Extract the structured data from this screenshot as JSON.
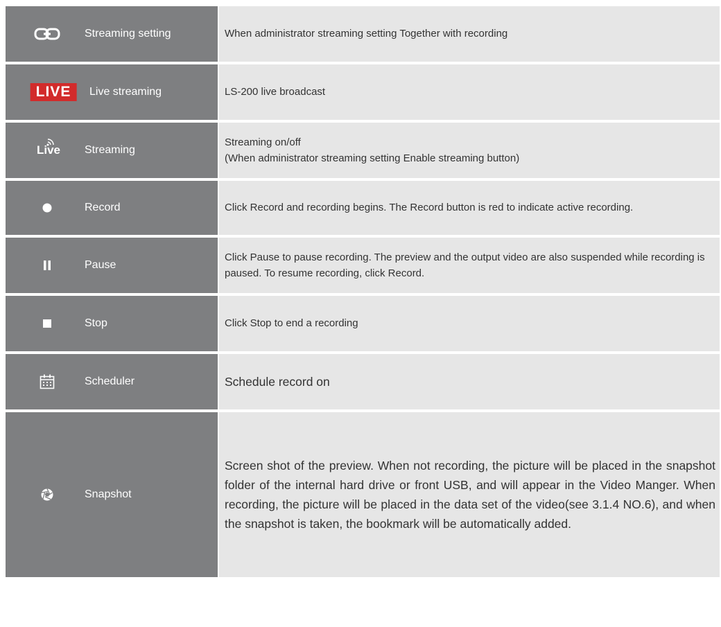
{
  "rows": [
    {
      "icon": "link-icon",
      "label": "Streaming setting",
      "desc": "When administrator streaming setting Together with recording"
    },
    {
      "icon": "live-badge-icon",
      "badge": "LIVE",
      "label": "Live streaming",
      "desc": "LS-200 live broadcast"
    },
    {
      "icon": "live-signal-icon",
      "label": "Streaming",
      "desc_lines": [
        "Streaming on/off",
        "(When administrator streaming setting Enable streaming button)"
      ]
    },
    {
      "icon": "record-dot-icon",
      "label": "Record",
      "desc": "Click Record and recording begins. The Record button is red to indicate active recording."
    },
    {
      "icon": "pause-icon",
      "label": "Pause",
      "desc": "Click Pause to pause recording. The preview and the output video are also suspended while recording is paused. To resume recording, click Record."
    },
    {
      "icon": "stop-square-icon",
      "label": "Stop",
      "desc": "Click Stop to end a recording"
    },
    {
      "icon": "calendar-icon",
      "label": "Scheduler",
      "desc": "Schedule record on"
    },
    {
      "icon": "aperture-icon",
      "label": "Snapshot",
      "desc": "Screen shot of the preview. When not recording, the picture will be placed in the snapshot folder of the internal hard drive or front USB, and will appear in the Video Manger. When recording, the picture will be placed in the data set of the video(see 3.1.4 NO.6), and when the snapshot is taken, the bookmark will be automatically added."
    }
  ],
  "live_icon_text": "Live"
}
